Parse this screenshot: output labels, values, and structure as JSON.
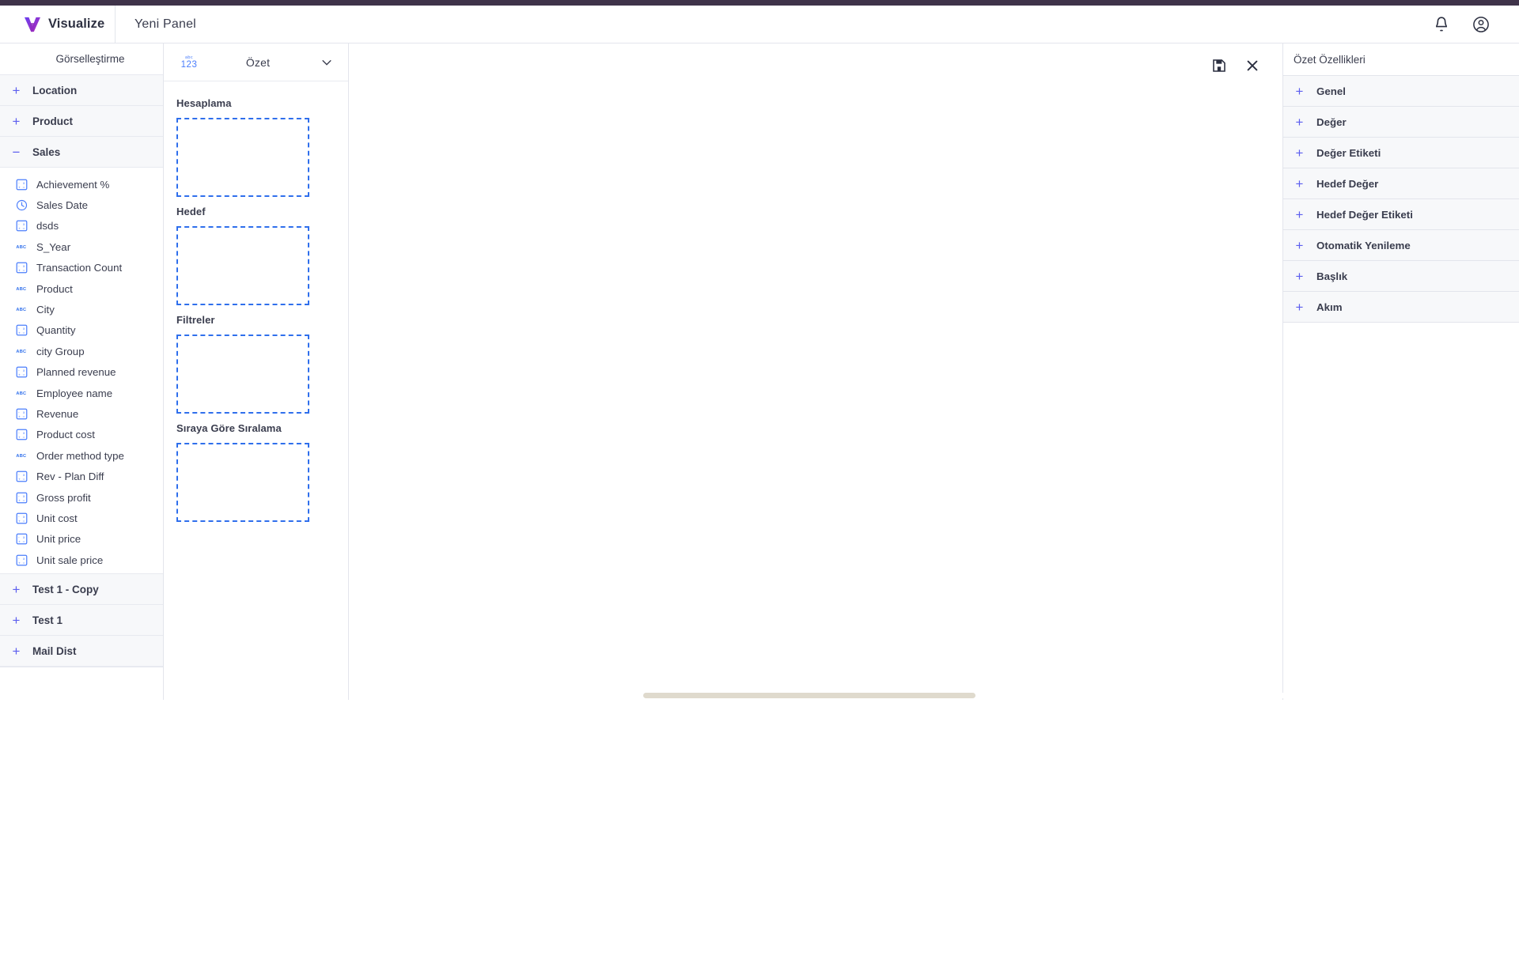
{
  "window": {
    "accent_purple": "#3f3349",
    "accent_blue": "#5d5fef",
    "dropzone_blue": "#2f6fec",
    "field_icon_blue": "#4a7dfc"
  },
  "header": {
    "brand_name": "Visualize",
    "panel_title": "Yeni Panel",
    "logo_icon": "visualize-v-logo",
    "notification_icon": "bell-icon",
    "account_icon": "user-circle-icon"
  },
  "sidebar": {
    "title": "Görselleştirme",
    "groups": [
      {
        "label": "Location",
        "expanded": false,
        "toggle": "+"
      },
      {
        "label": "Product",
        "expanded": false,
        "toggle": "+"
      },
      {
        "label": "Sales",
        "expanded": true,
        "toggle": "−"
      }
    ],
    "fields": [
      {
        "label": "Achievement %",
        "icon": "measure-icon"
      },
      {
        "label": "Sales Date",
        "icon": "clock-icon"
      },
      {
        "label": "dsds",
        "icon": "measure-icon"
      },
      {
        "label": "S_Year",
        "icon": "abc-icon"
      },
      {
        "label": "Transaction Count",
        "icon": "measure-icon"
      },
      {
        "label": "Product",
        "icon": "abc-icon"
      },
      {
        "label": "City",
        "icon": "abc-icon"
      },
      {
        "label": "Quantity",
        "icon": "measure-icon"
      },
      {
        "label": "city Group",
        "icon": "abc-icon"
      },
      {
        "label": "Planned revenue",
        "icon": "measure-icon"
      },
      {
        "label": "Employee name",
        "icon": "abc-icon"
      },
      {
        "label": "Revenue",
        "icon": "measure-icon"
      },
      {
        "label": "Product cost",
        "icon": "measure-icon"
      },
      {
        "label": "Order method type",
        "icon": "abc-icon"
      },
      {
        "label": "Rev - Plan Diff",
        "icon": "measure-icon"
      },
      {
        "label": "Gross profit",
        "icon": "measure-icon"
      },
      {
        "label": "Unit cost",
        "icon": "measure-icon"
      },
      {
        "label": "Unit price",
        "icon": "measure-icon"
      },
      {
        "label": "Unit sale price",
        "icon": "measure-icon"
      }
    ],
    "groups_bottom": [
      {
        "label": "Test 1 - Copy",
        "toggle": "+"
      },
      {
        "label": "Test 1",
        "toggle": "+"
      },
      {
        "label": "Mail Dist",
        "toggle": "+"
      }
    ]
  },
  "shelf": {
    "viz_type_icon": "abc-123-icon",
    "viz_type_icon_top": "abc",
    "viz_type_icon_bottom": "123",
    "selected_chart": "Özet",
    "dropdown_icon": "chevron-down-icon",
    "groups": [
      {
        "label": "Hesaplama",
        "placeholder": ""
      },
      {
        "label": "Hedef",
        "placeholder": ""
      },
      {
        "label": "Filtreler",
        "placeholder": ""
      },
      {
        "label": "Sıraya Göre Sıralama",
        "placeholder": ""
      }
    ]
  },
  "canvas": {
    "save_icon": "save-floppy-icon",
    "close_icon": "close-x-icon",
    "scrollbar": "horizontal-scrollbar"
  },
  "properties": {
    "title": "Özet Özellikleri",
    "sections": [
      {
        "label": "Genel",
        "toggle": "+"
      },
      {
        "label": "Değer",
        "toggle": "+"
      },
      {
        "label": "Değer Etiketi",
        "toggle": "+"
      },
      {
        "label": "Hedef Değer",
        "toggle": "+"
      },
      {
        "label": "Hedef Değer Etiketi",
        "toggle": "+"
      },
      {
        "label": "Otomatik Yenileme",
        "toggle": "+"
      },
      {
        "label": "Başlık",
        "toggle": "+"
      },
      {
        "label": "Akım",
        "toggle": "+"
      }
    ]
  }
}
